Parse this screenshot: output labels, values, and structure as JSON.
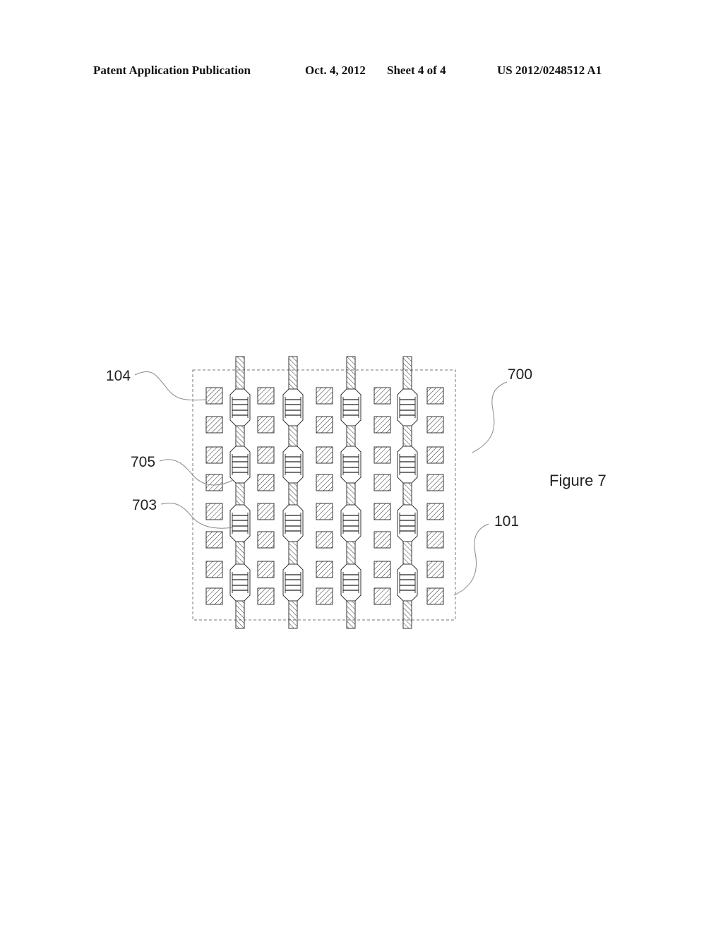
{
  "header": {
    "publication_type": "Patent Application Publication",
    "date": "Oct. 4, 2012",
    "sheet": "Sheet 4 of 4",
    "publication_number": "US 2012/0248512 A1"
  },
  "figure": {
    "title": "Figure 7",
    "reference_labels": [
      {
        "id": "104",
        "text": "104",
        "refers_to": "pad"
      },
      {
        "id": "705",
        "text": "705",
        "refers_to": "pad"
      },
      {
        "id": "703",
        "text": "703",
        "refers_to": "connector"
      },
      {
        "id": "700",
        "text": "700",
        "refers_to": "assembly"
      },
      {
        "id": "101",
        "text": "101",
        "refers_to": "substrate-boundary"
      }
    ],
    "grid": {
      "pad_rows": 8,
      "pad_columns": 5,
      "trace_count": 4,
      "connectors_per_trace": 4
    },
    "colors": {
      "line": "#333333",
      "border_dash": "#777777",
      "leader": "#888888"
    }
  }
}
